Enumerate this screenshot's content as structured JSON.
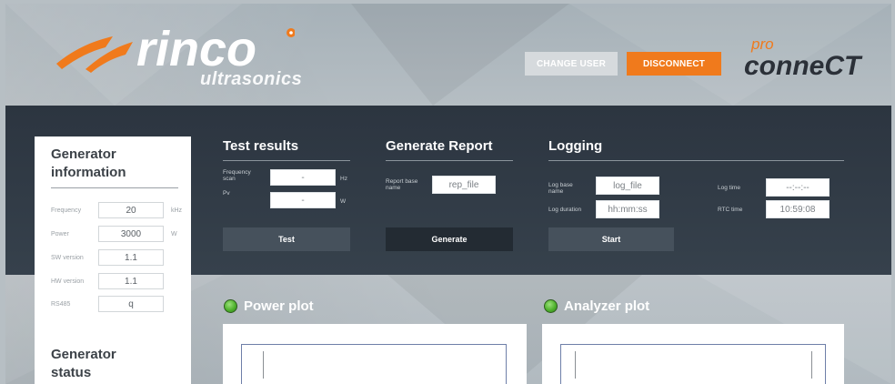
{
  "header": {
    "logo_text": "rinco",
    "logo_sub": "ultrasonics",
    "change_user_label": "CHANGE USER",
    "disconnect_label": "DISCONNECT",
    "pro_label": "pro",
    "connect_label": "conneCT"
  },
  "colors": {
    "accent": "#f07a1c",
    "band": "#2c3540",
    "led": "#4fb22d"
  },
  "generator_info": {
    "title_line1": "Generator",
    "title_line2": "information",
    "rows": [
      {
        "label": "Frequency",
        "value": "20",
        "unit": "kHz"
      },
      {
        "label": "Power",
        "value": "3000",
        "unit": "W"
      },
      {
        "label": "SW version",
        "value": "1.1",
        "unit": ""
      },
      {
        "label": "HW version",
        "value": "1.1",
        "unit": ""
      },
      {
        "label": "RS485",
        "value": "q",
        "unit": ""
      }
    ]
  },
  "generator_status": {
    "title_line1": "Generator",
    "title_line2": "status"
  },
  "test_results": {
    "title": "Test results",
    "freq_label": "Frequency scan",
    "freq_value": "-",
    "freq_unit": "Hz",
    "pv_label": "Pv",
    "pv_value": "-",
    "pv_unit": "W",
    "test_button": "Test"
  },
  "report": {
    "title": "Generate Report",
    "base_label": "Report base name",
    "base_value": "rep_file",
    "generate_button": "Generate"
  },
  "logging": {
    "title": "Logging",
    "base_label": "Log base name",
    "base_value": "log_file",
    "duration_label": "Log duration",
    "duration_placeholder": "hh:mm:ss",
    "log_time_label": "Log time",
    "log_time_value": "--:--:--",
    "rtc_label": "RTC time",
    "rtc_value": "10:59:08",
    "start_button": "Start"
  },
  "plots": {
    "power_title": "Power plot",
    "analyzer_title": "Analyzer plot"
  }
}
